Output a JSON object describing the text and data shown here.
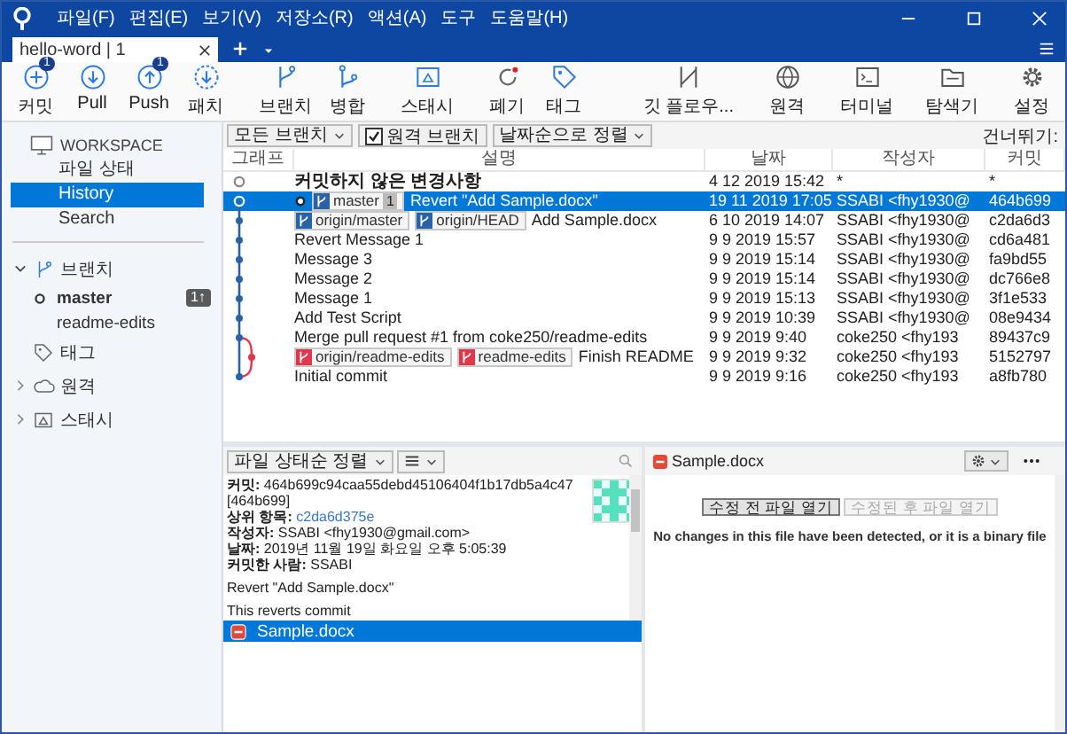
{
  "window": {
    "menu": [
      "파일(F)",
      "편집(E)",
      "보기(V)",
      "저장소(R)",
      "액션(A)",
      "도구",
      "도움말(H)"
    ]
  },
  "tabs": [
    {
      "label": "hello-word | 1",
      "selected": true
    }
  ],
  "toolbar": {
    "left": [
      [
        {
          "kind": "commit",
          "label": "커밋",
          "badge": "1"
        },
        {
          "kind": "pull",
          "label": "Pull"
        },
        {
          "kind": "push",
          "label": "Push",
          "badge": "1"
        },
        {
          "kind": "fetch",
          "label": "패치"
        }
      ],
      [
        {
          "kind": "branch",
          "label": "브랜치"
        },
        {
          "kind": "merge",
          "label": "병합"
        }
      ],
      [
        {
          "kind": "stash",
          "label": "스태시"
        }
      ],
      [
        {
          "kind": "discard",
          "label": "폐기"
        },
        {
          "kind": "tag",
          "label": "태그"
        }
      ]
    ],
    "right": [
      {
        "kind": "flow",
        "label": "깃 플로우..."
      },
      {
        "kind": "remote",
        "label": "원격"
      },
      {
        "kind": "terminal",
        "label": "터미널"
      },
      {
        "kind": "explorer",
        "label": "탐색기"
      },
      {
        "kind": "settings",
        "label": "설정"
      }
    ]
  },
  "sidebar": {
    "workspace": {
      "title": "WORKSPACE",
      "items": [
        {
          "label": "파일 상태",
          "selected": false
        },
        {
          "label": "History",
          "selected": true
        },
        {
          "label": "Search",
          "selected": false
        }
      ]
    },
    "sections": [
      {
        "kind": "branches",
        "label": "브랜치",
        "expanded": true,
        "children": [
          {
            "label": "master",
            "current": true,
            "badge": "1↑"
          },
          {
            "label": "readme-edits",
            "current": false
          }
        ]
      },
      {
        "kind": "tags",
        "label": "태그"
      },
      {
        "kind": "remotes",
        "label": "원격",
        "expanded": false
      },
      {
        "kind": "stashes",
        "label": "스태시",
        "expanded": false
      }
    ]
  },
  "history": {
    "filters": {
      "branches": "모든 브랜치",
      "remote_branches": {
        "label": "원격 브랜치",
        "checked": true
      },
      "order": "날짜순으로 정렬",
      "jump": "건너뛰기:"
    },
    "columns": [
      "그래프",
      "설명",
      "날짜",
      "작성자",
      "커밋"
    ],
    "rows": [
      {
        "kind": "uncommitted",
        "description": "커밋하지 않은 변경사항",
        "date": "4 12 2019 15:42",
        "author": "*",
        "commit": "*",
        "selected": false
      },
      {
        "kind": "commit",
        "refs": [
          {
            "label": "master",
            "ahead": "1",
            "color": "#2a62a8"
          }
        ],
        "description": "Revert \"Add Sample.docx\"",
        "date": "19 11 2019 17:05",
        "author": "SSABI <fhy1930@",
        "commit": "464b699",
        "selected": true
      },
      {
        "kind": "commit",
        "refs": [
          {
            "label": "origin/master",
            "color": "#2a62a8"
          },
          {
            "label": "origin/HEAD",
            "color": "#2a62a8"
          }
        ],
        "description": "Add Sample.docx",
        "date": "6 10 2019 14:07",
        "author": "SSABI <fhy1930@",
        "commit": "c2da6d3",
        "selected": false
      },
      {
        "kind": "commit",
        "description": "Revert Message 1",
        "date": "9 9 2019 15:57",
        "author": "SSABI <fhy1930@",
        "commit": "cd6a481",
        "selected": false
      },
      {
        "kind": "commit",
        "description": "Message 3",
        "date": "9 9 2019 15:14",
        "author": "SSABI <fhy1930@",
        "commit": "fa9bd55",
        "selected": false
      },
      {
        "kind": "commit",
        "description": "Message 2",
        "date": "9 9 2019 15:14",
        "author": "SSABI <fhy1930@",
        "commit": "dc766e8",
        "selected": false
      },
      {
        "kind": "commit",
        "description": "Message 1",
        "date": "9 9 2019 15:13",
        "author": "SSABI <fhy1930@",
        "commit": "3f1e533",
        "selected": false
      },
      {
        "kind": "commit",
        "description": "Add Test Script",
        "date": "9 9 2019 10:39",
        "author": "SSABI <fhy1930@",
        "commit": "08e9434",
        "selected": false
      },
      {
        "kind": "commit",
        "description": "Merge pull request #1 from coke250/readme-edits",
        "date": "9 9 2019 9:40",
        "author": "coke250 <fhy193",
        "commit": "89437c9",
        "selected": false
      },
      {
        "kind": "commit",
        "refs": [
          {
            "label": "origin/readme-edits",
            "color": "#e0374d"
          },
          {
            "label": "readme-edits",
            "color": "#e0374d"
          }
        ],
        "description": "Finish README",
        "date": "9 9 2019 9:32",
        "author": "coke250 <fhy193",
        "commit": "5152797",
        "selected": false
      },
      {
        "kind": "commit",
        "description": "Initial commit",
        "date": "9 9 2019 9:16",
        "author": "coke250 <fhy193",
        "commit": "a8fb780",
        "selected": false
      }
    ]
  },
  "details": {
    "sort": "파일 상태순 정렬",
    "fields": [
      {
        "label": "커밋:",
        "value": "464b699c94caa55debd45106404f1b17db5a4c47 [464b699]"
      },
      {
        "label": "상위 항목:",
        "value": "c2da6d375e",
        "kind": "link"
      },
      {
        "label": "작성자:",
        "value": "SSABI <fhy1930@gmail.com>"
      },
      {
        "label": "날짜:",
        "value": "2019년 11월 19일 화요일 오후 5:05:39"
      },
      {
        "label": "커밋한 사람:",
        "value": "SSABI"
      }
    ],
    "message": [
      "Revert \"Add Sample.docx\"",
      "This reverts commit"
    ],
    "files": [
      {
        "name": "Sample.docx",
        "selected": true
      }
    ]
  },
  "diff": {
    "file": {
      "name": "Sample.docx"
    },
    "buttons": [
      {
        "label": "수정 전 파일 열기",
        "disabled": false
      },
      {
        "label": "수정된 후 파일 열기",
        "disabled": true
      }
    ],
    "message": "No changes in this file have been detected, or it is a binary file"
  }
}
